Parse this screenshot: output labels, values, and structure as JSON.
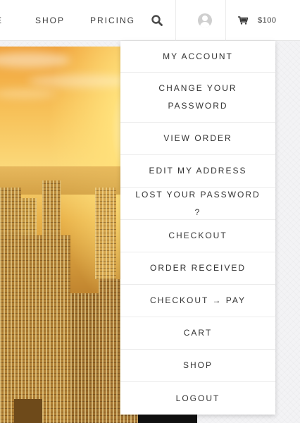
{
  "nav": {
    "partial_label": "E",
    "shop_label": "SHOP",
    "pricing_label": "PRICING",
    "search_icon": "search-icon",
    "user_icon": "user-avatar-icon",
    "cart_icon": "cart-icon",
    "cart_total": "$100"
  },
  "dropdown": {
    "items": [
      {
        "label": "MY ACCOUNT"
      },
      {
        "label": "CHANGE YOUR PASSWORD"
      },
      {
        "label": "VIEW ORDER"
      },
      {
        "label": "EDIT MY ADDRESS"
      },
      {
        "label": "LOST YOUR PASSWORD ?"
      },
      {
        "label": "CHECKOUT"
      },
      {
        "label": "ORDER RECEIVED"
      },
      {
        "label": "CHECKOUT → PAY"
      },
      {
        "label": "CART"
      },
      {
        "label": "SHOP"
      },
      {
        "label": "LOGOUT"
      }
    ]
  },
  "colors": {
    "nav_text": "#3a3a3a",
    "menu_text": "#333333",
    "divider": "#ececec",
    "hero_accent": "#f7c25a"
  }
}
